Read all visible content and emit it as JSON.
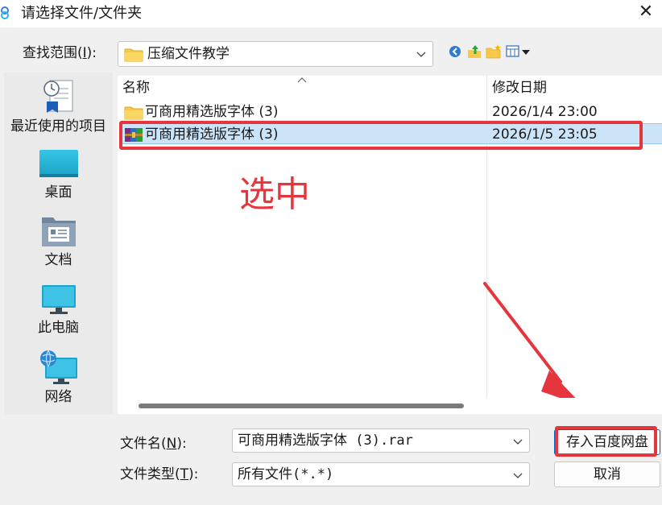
{
  "window": {
    "title": "请选择文件/文件夹",
    "close_glyph": "✕"
  },
  "lookin": {
    "label_prefix": "查找范围(",
    "label_key": "I",
    "label_suffix": "):",
    "value": "压缩文件教学"
  },
  "toolbar": {
    "icons": [
      "back-icon",
      "up-folder-icon",
      "new-folder-icon",
      "view-menu-icon"
    ]
  },
  "places": [
    {
      "label": "最近使用的项目",
      "icon": "recent-items-icon"
    },
    {
      "label": "桌面",
      "icon": "desktop-icon"
    },
    {
      "label": "文档",
      "icon": "documents-icon"
    },
    {
      "label": "此电脑",
      "icon": "computer-icon"
    },
    {
      "label": "网络",
      "icon": "network-icon"
    }
  ],
  "filelist": {
    "columns": {
      "name": "名称",
      "modified": "修改日期"
    },
    "rows": [
      {
        "name": "可商用精选版字体 (3)",
        "modified": "2026/1/4 23:00",
        "type": "folder",
        "selected": false
      },
      {
        "name": "可商用精选版字体 (3)",
        "modified": "2026/1/5 23:05",
        "type": "rar",
        "selected": true
      }
    ]
  },
  "annotation": {
    "text": "选中",
    "color": "#e5363d"
  },
  "filename": {
    "label_prefix": "文件名(",
    "label_key": "N",
    "label_suffix": "):",
    "value": "可商用精选版字体 (3).rar"
  },
  "filetype": {
    "label_prefix": "文件类型(",
    "label_key": "T",
    "label_suffix": "):",
    "value": "所有文件(*.*)"
  },
  "buttons": {
    "save": "存入百度网盘",
    "cancel": "取消"
  },
  "colors": {
    "accent": "#0067c0",
    "selection": "#cce4f7",
    "highlight": "#e5363d"
  }
}
